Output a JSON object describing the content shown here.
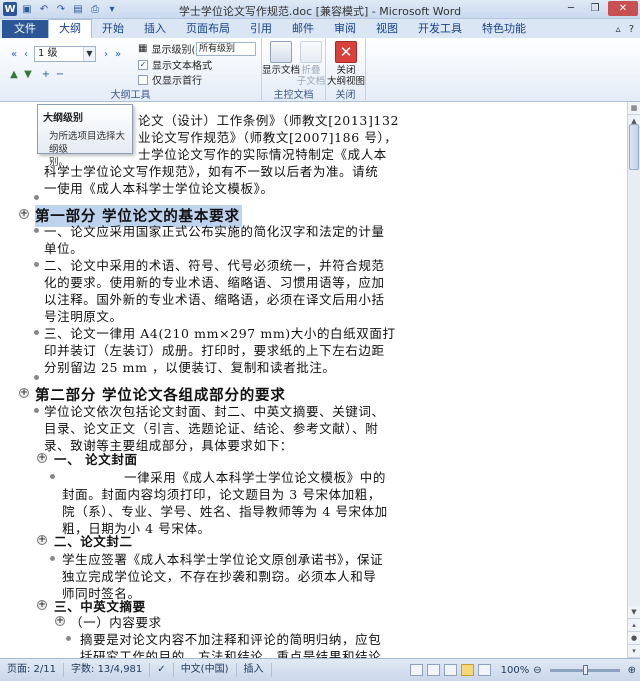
{
  "window": {
    "title": "学士学位论文写作规范.doc [兼容模式] - Microsoft Word",
    "controls": [
      "minimize",
      "restore",
      "close"
    ]
  },
  "qat": {
    "app_icon_letter": "W",
    "icons": [
      "save-icon",
      "undo-icon",
      "redo-icon",
      "print-preview-icon",
      "print-icon",
      "customize-icon"
    ]
  },
  "tabs": {
    "file": "文件",
    "items": [
      "大纲",
      "开始",
      "插入",
      "页面布局",
      "引用",
      "邮件",
      "审阅",
      "视图",
      "开发工具",
      "特色功能"
    ],
    "active": "大纲"
  },
  "ribbon": {
    "outline_tools": {
      "label": "大纲工具",
      "level_value": "1 级",
      "show_level_label": "显示级别(S):",
      "show_level_value": "所有级别",
      "show_text_format_label": "显示文本格式",
      "show_text_format_checked": true,
      "show_first_line_label": "仅显示首行",
      "show_first_line_checked": false
    },
    "master_document": {
      "label": "主控文档",
      "show_document": "显示文档",
      "collapse_subdocs_line1": "折叠",
      "collapse_subdocs_line2": "子文档"
    },
    "close_group": {
      "label": "关闭",
      "close_line1": "关闭",
      "close_line2": "大纲视图"
    }
  },
  "tooltip": {
    "title": "大纲级别",
    "body_line1": "为所选项目选择大纲级",
    "body_line2": "别。"
  },
  "document": {
    "lines": [
      {
        "text": "论文（设计）工作条例》（师教文[2013]132",
        "kind": "body"
      },
      {
        "text": "业论文写作规范》（师教文[2007]186 号），",
        "kind": "body"
      },
      {
        "text": "士学位论文写作的实际情况特制定《成人本",
        "kind": "body"
      },
      {
        "text": "科学士学位论文写作规范》，如有不一致以后者为准。请统",
        "kind": "body"
      },
      {
        "text": "一使用《成人本科学士学位论文模板》。",
        "kind": "body"
      },
      {
        "text": "第一部分   学位论文的基本要求",
        "kind": "h1"
      },
      {
        "text": "一、论文应采用国家正式公布实施的简化汉字和法定的计量",
        "kind": "body"
      },
      {
        "text": "单位。",
        "kind": "body"
      },
      {
        "text": "二、论文中采用的术语、符号、代号必须统一，并符合规范",
        "kind": "body"
      },
      {
        "text": "化的要求。使用新的专业术语、缩略语、习惯用语等，应加",
        "kind": "body"
      },
      {
        "text": "以注释。国外新的专业术语、缩略语，必须在译文后用小括",
        "kind": "body"
      },
      {
        "text": "号注明原文。",
        "kind": "body"
      },
      {
        "text": "三、论文一律用   A4(210  mm×297  mm)大小的白纸双面打",
        "kind": "body"
      },
      {
        "text": "印并装订（左装订）成册。打印时，要求纸的上下左右边距",
        "kind": "body"
      },
      {
        "text": "分别留边 25 mm  ，以便装订、复制和读者批注。",
        "kind": "body"
      },
      {
        "text": "第二部分   学位论文各组成部分的要求",
        "kind": "h1"
      },
      {
        "text": "学位论文依次包括论文封面、封二、中英文摘要、关键词、",
        "kind": "body"
      },
      {
        "text": "目录、论文正文（引言、选题论证、结论、参考文献）、附",
        "kind": "body"
      },
      {
        "text": "录、致谢等主要组成部分，具体要求如下：",
        "kind": "body"
      },
      {
        "text": "一、    论文封面",
        "kind": "h2"
      },
      {
        "text": "一律采用《成人本科学士学位论文模板》中的",
        "kind": "body"
      },
      {
        "text": "封面。封面内容均须打印，论文题目为 3 号宋体加粗，",
        "kind": "body"
      },
      {
        "text": "院（系）、专业、学号、姓名、指导教师等为 4 号宋体加",
        "kind": "body"
      },
      {
        "text": "粗，日期为小 4 号宋体。",
        "kind": "body"
      },
      {
        "text": "二、论文封二",
        "kind": "h2"
      },
      {
        "text": "学生应签署《成人本科学士学位论文原创承诺书》，保证",
        "kind": "body"
      },
      {
        "text": "独立完成学位论文，不存在抄袭和剽窃。必须本人和导",
        "kind": "body"
      },
      {
        "text": "师同时签名。",
        "kind": "body"
      },
      {
        "text": "三、中英文摘要",
        "kind": "h2"
      },
      {
        "text": "（一）内容要求",
        "kind": "h3"
      },
      {
        "text": "摘要是对论文内容不加注释和评论的简明归纳，应包",
        "kind": "body"
      },
      {
        "text": "括研究工作的目的、方法和结论，重点是结果和结论。",
        "kind": "body"
      }
    ]
  },
  "statusbar": {
    "page": "页面: 2/11",
    "words": "字数: 13/4,981",
    "language": "中文(中国)",
    "mode": "插入",
    "zoom": "100%",
    "zoom_percent": 100
  }
}
